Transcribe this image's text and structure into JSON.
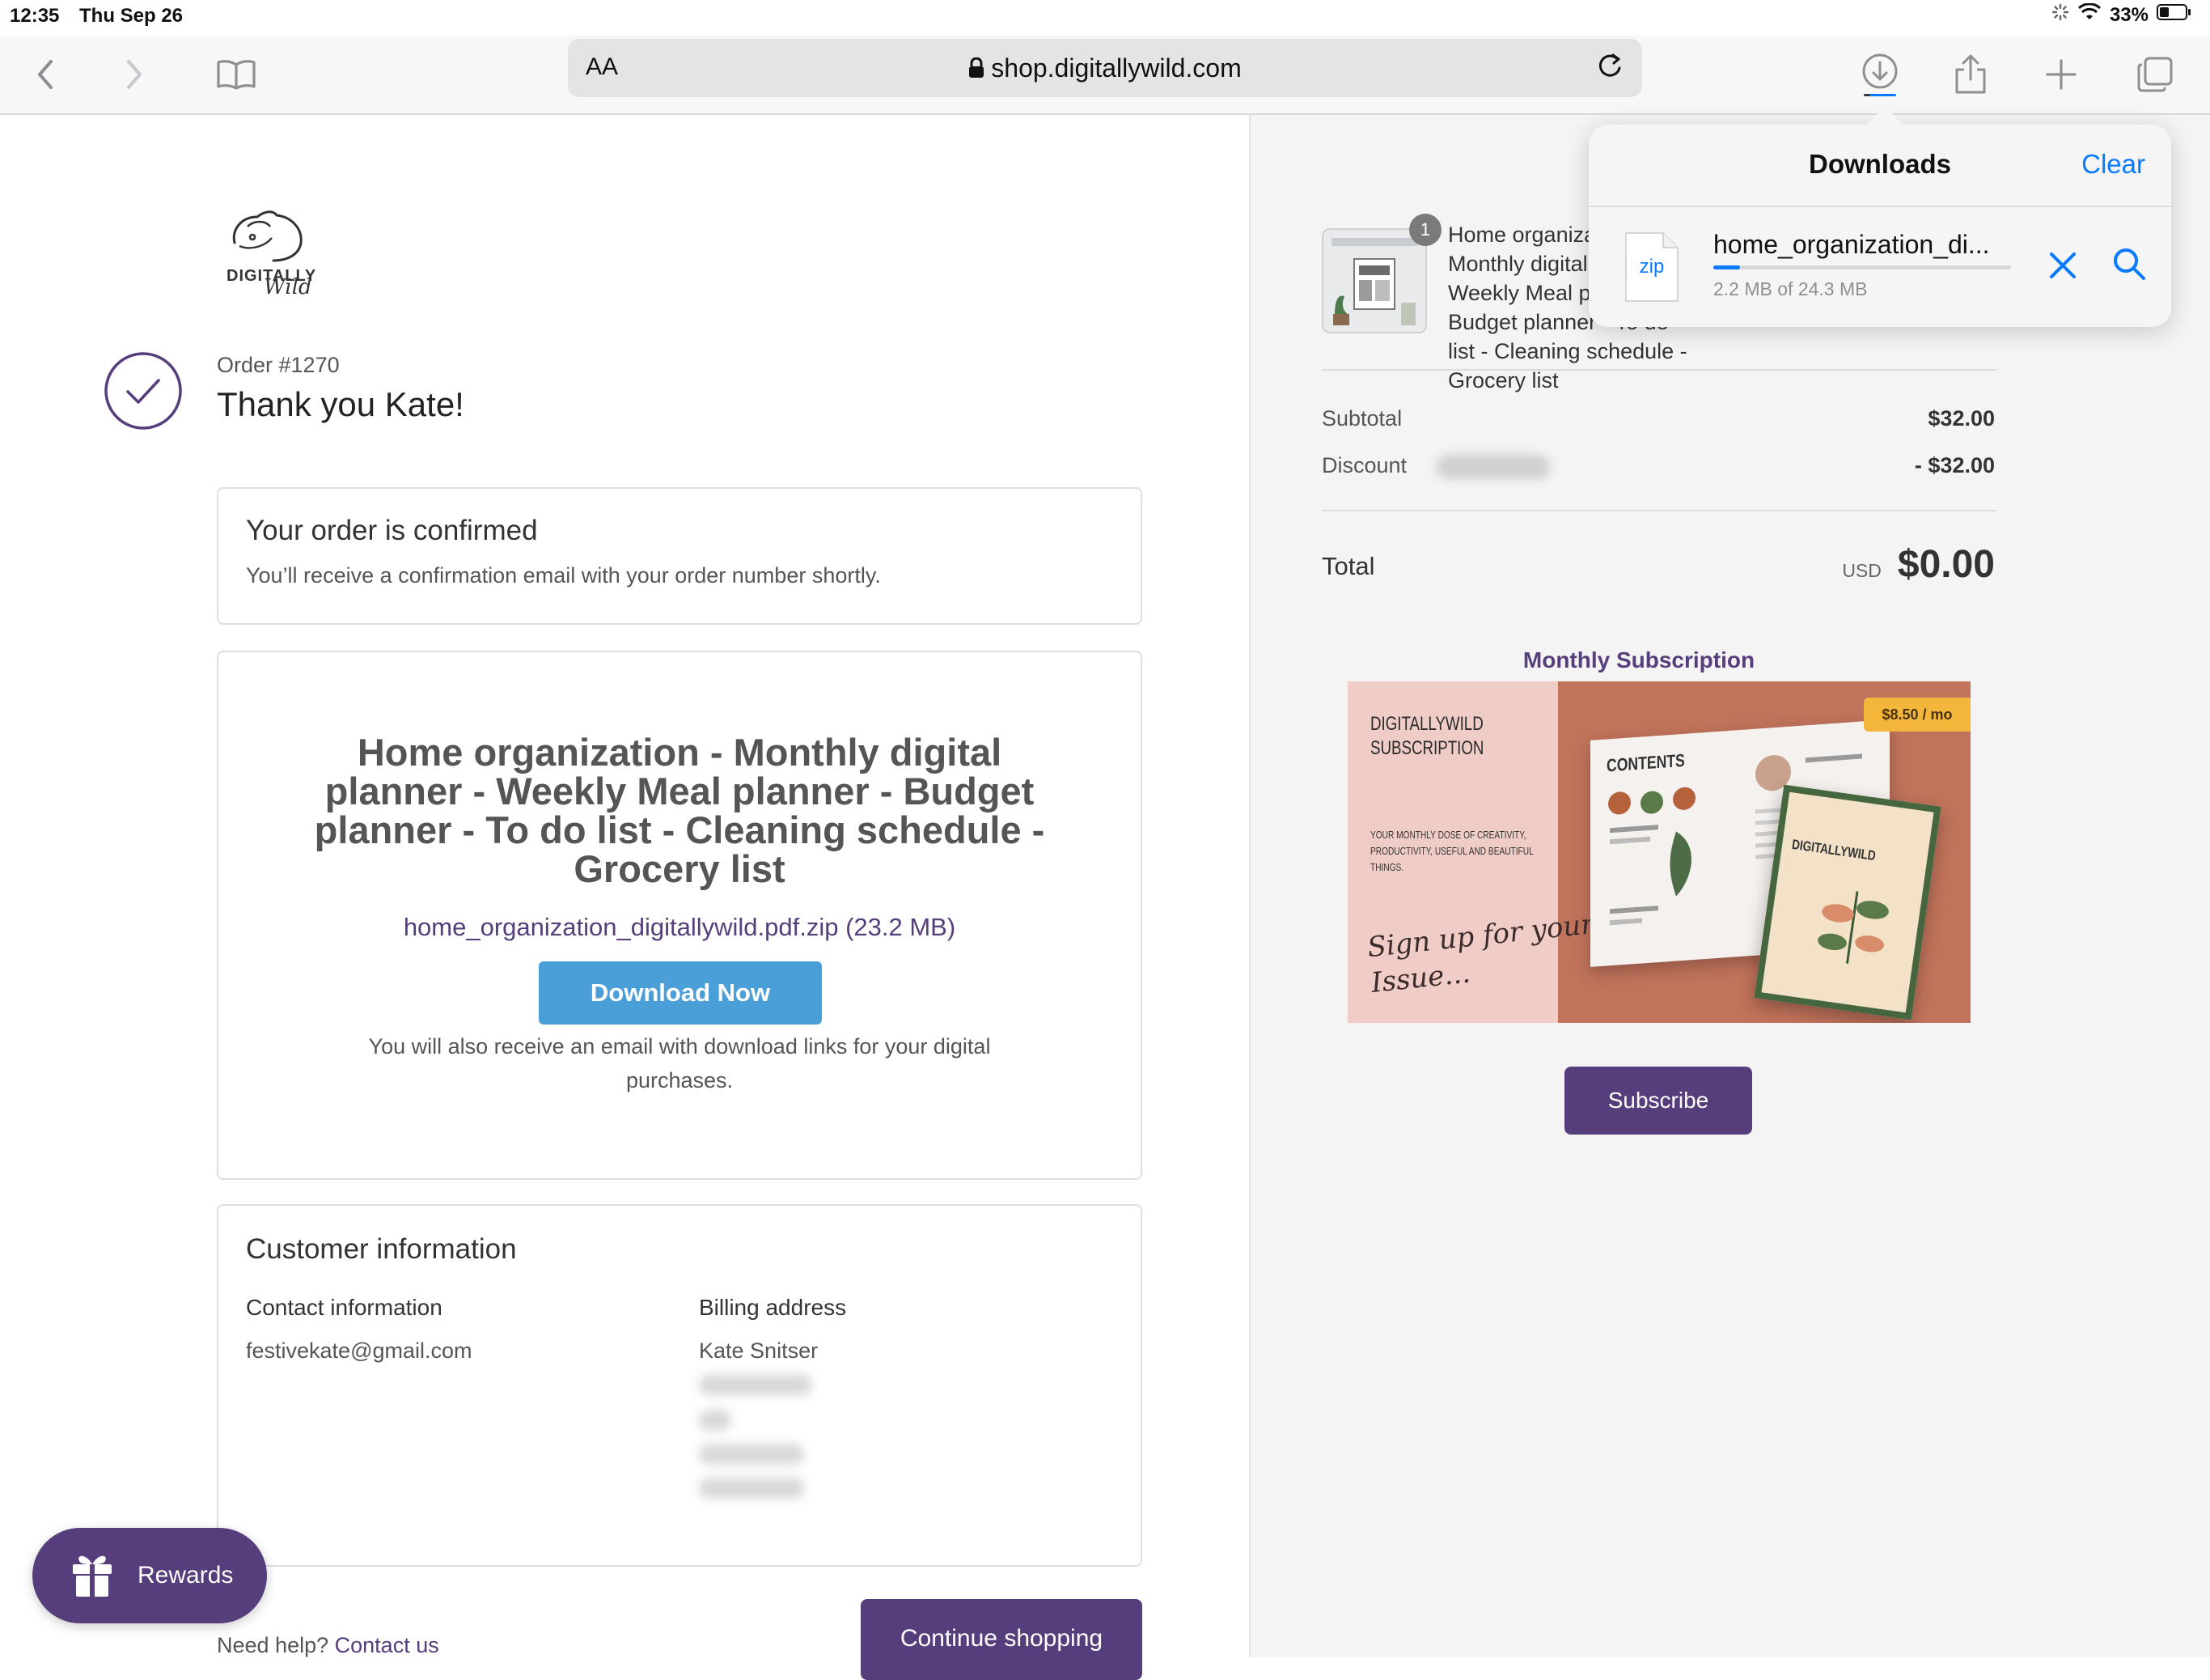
{
  "status": {
    "time": "12:35",
    "date": "Thu Sep 26",
    "battery": "33%"
  },
  "browser": {
    "aa_label": "AA",
    "url": "shop.digitallywild.com"
  },
  "store": {
    "logo_line1": "DIGITALLY",
    "logo_line2": "Wild"
  },
  "order": {
    "number": "Order #1270",
    "thank_you": "Thank you Kate!"
  },
  "confirmed": {
    "title": "Your order is confirmed",
    "message": "You’ll receive a confirmation email with your order number shortly."
  },
  "download": {
    "product_title": "Home organization - Monthly digital planner - Weekly Meal planner - Budget planner - To do list - Cleaning schedule - Grocery list",
    "file_link": "home_organization_digitallywild.pdf.zip (23.2 MB)",
    "button_label": "Download Now",
    "note": "You will also receive an email with download links for your digital purchases."
  },
  "customer": {
    "title": "Customer information",
    "contact_label": "Contact information",
    "email": "festivekate@gmail.com",
    "billing_label": "Billing address",
    "name": "Kate Snitser"
  },
  "footer": {
    "need_help": "Need help?",
    "contact_link": "Contact us",
    "continue_label": "Continue shopping"
  },
  "rewards": {
    "label": "Rewards"
  },
  "summary": {
    "item_qty": "1",
    "item_title": "Home organization - Monthly digital planner - Weekly Meal planner - Budget planner - To do list - Cleaning schedule - Grocery list",
    "subtotal_label": "Subtotal",
    "subtotal_value": "$32.00",
    "discount_label": "Discount",
    "discount_value": "- $32.00",
    "total_label": "Total",
    "currency": "USD",
    "total_value": "$0.00"
  },
  "promo": {
    "heading": "Monthly Subscription",
    "banner_title1": "DIGITALLYWILD",
    "banner_title2": "SUBSCRIPTION",
    "banner_tagline": "YOUR MONTHLY DOSE OF CREATIVITY, PRODUCTIVITY, USEFUL AND BEAUTIFUL THINGS.",
    "banner_script": "Sign up for your Issue...",
    "banner_price": "$8.50 / mo",
    "mag_contents": "CONTENTS",
    "mag_cover": "DIGITALLYWILD",
    "subscribe_label": "Subscribe"
  },
  "downloads": {
    "title": "Downloads",
    "clear_label": "Clear",
    "file_type": "zip",
    "file_name": "home_organization_di...",
    "progress_text": "2.2 MB of 24.3 MB",
    "progress": 0.09
  },
  "colors": {
    "brand_purple": "#563d7c",
    "download_blue": "#4a9fd8",
    "ios_blue": "#0a7aff"
  }
}
